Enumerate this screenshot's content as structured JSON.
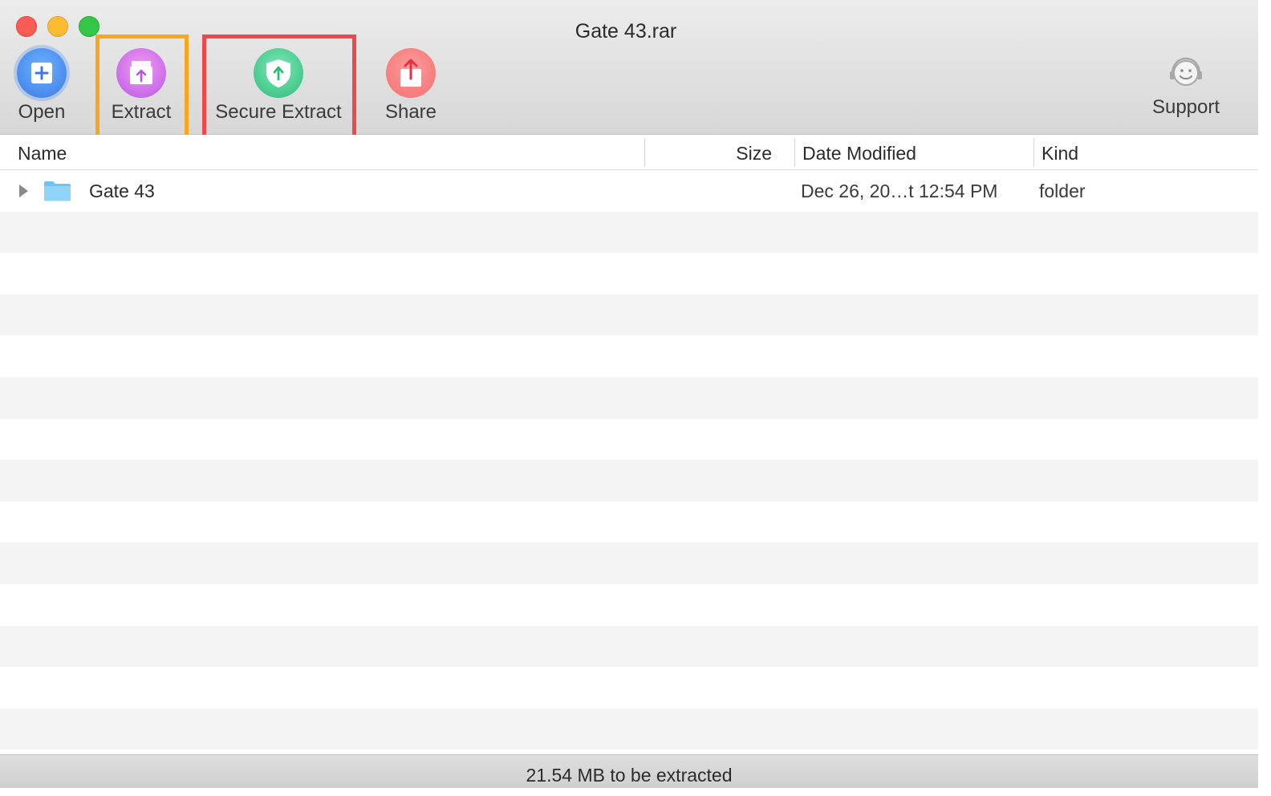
{
  "window": {
    "title": "Gate 43.rar"
  },
  "toolbar": {
    "open_label": "Open",
    "extract_label": "Extract",
    "secure_extract_label": "Secure Extract",
    "share_label": "Share",
    "support_label": "Support"
  },
  "highlights": {
    "extract_color": "#f6a81a",
    "secure_extract_color": "#f0474a"
  },
  "columns": {
    "name": "Name",
    "size": "Size",
    "date_modified": "Date Modified",
    "kind": "Kind"
  },
  "files": [
    {
      "name": "Gate 43",
      "size": "",
      "date_modified": "Dec 26, 20…t 12:54 PM",
      "kind": "folder",
      "icon": "folder-icon",
      "expandable": true
    }
  ],
  "status": {
    "text": "21.54 MB to be extracted"
  }
}
